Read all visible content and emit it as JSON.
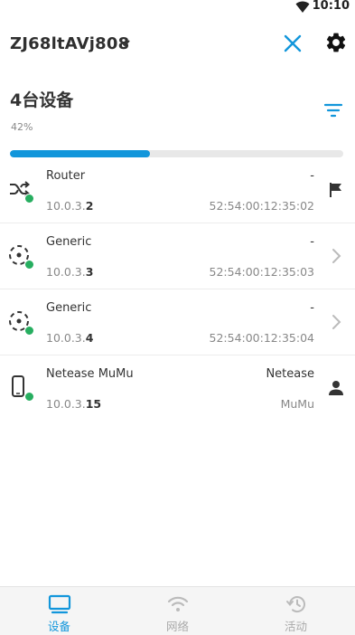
{
  "status": {
    "time": "10:10"
  },
  "header": {
    "network_name": "ZJ68ltAVj808"
  },
  "summary": {
    "device_count": "4台设备",
    "scan_percent": "42%",
    "scan_progress": 0.42
  },
  "devices": [
    {
      "name": "Router",
      "vendor": "-",
      "ip_prefix": "10.0.3.",
      "ip_suffix": "2",
      "mac": "52:54:00:12:35:02",
      "icon": "router-shuffle-icon",
      "action_icon": "flag-icon"
    },
    {
      "name": "Generic",
      "vendor": "-",
      "ip_prefix": "10.0.3.",
      "ip_suffix": "3",
      "mac": "52:54:00:12:35:03",
      "icon": "generic-device-icon",
      "action_icon": "chevron-right-icon"
    },
    {
      "name": "Generic",
      "vendor": "-",
      "ip_prefix": "10.0.3.",
      "ip_suffix": "4",
      "mac": "52:54:00:12:35:04",
      "icon": "generic-device-icon",
      "action_icon": "chevron-right-icon"
    },
    {
      "name": "Netease MuMu",
      "vendor": "Netease",
      "ip_prefix": "10.0.3.",
      "ip_suffix": "15",
      "mac": "MuMu",
      "icon": "phone-icon",
      "action_icon": "person-icon"
    }
  ],
  "nav": [
    {
      "label": "设备",
      "icon": "monitor-icon",
      "active": true
    },
    {
      "label": "网络",
      "icon": "wifi-icon",
      "active": false
    },
    {
      "label": "活动",
      "icon": "history-icon",
      "active": false
    }
  ],
  "colors": {
    "accent": "#1296db",
    "online": "#27ae60",
    "progress_track": "#e8e8e8"
  }
}
